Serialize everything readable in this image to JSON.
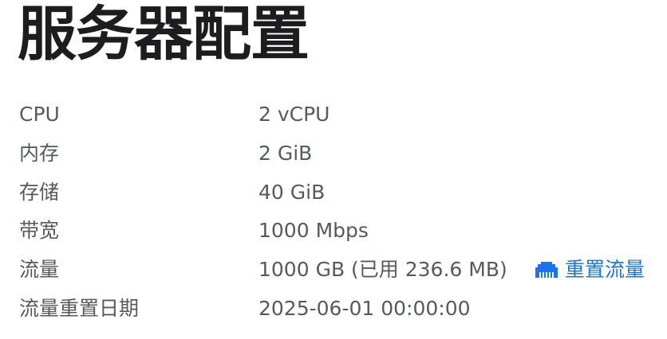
{
  "page": {
    "title": "服务器配置"
  },
  "specs": [
    {
      "label": "CPU",
      "value": "2 vCPU"
    },
    {
      "label": "内存",
      "value": "2 GiB"
    },
    {
      "label": "存储",
      "value": "40 GiB"
    },
    {
      "label": "带宽",
      "value": "1000 Mbps"
    },
    {
      "label": "流量",
      "value": "1000 GB (已用 236.6 MB)"
    },
    {
      "label": "流量重置日期",
      "value": "2025-06-01 00:00:00"
    }
  ],
  "actions": {
    "reset_traffic_label": "重置流量",
    "reset_traffic_icon": "ethernet-port-icon"
  },
  "colors": {
    "title": "#1d1d1f",
    "text": "#555a5e",
    "link": "#1a73e8"
  }
}
